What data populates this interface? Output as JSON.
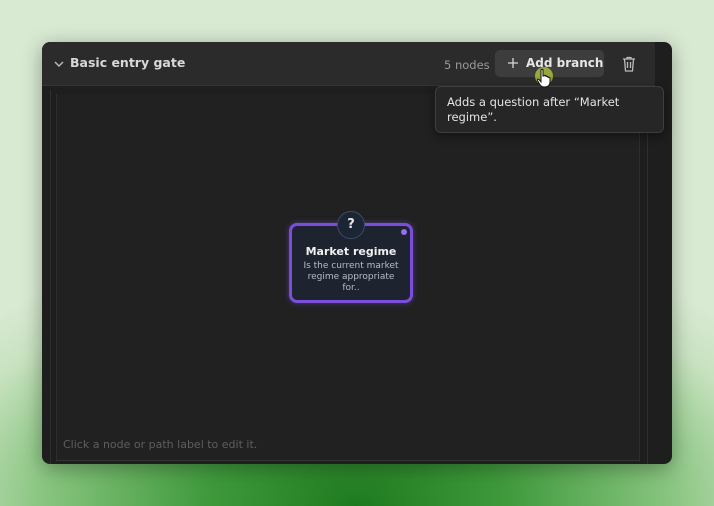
{
  "panel": {
    "title": "Basic entry gate",
    "node_count": "5 nodes",
    "add_branch_label": "Add branch",
    "hint": "Click a node or path label to edit it."
  },
  "tooltip": {
    "text": "Adds a question after “Market regime”."
  },
  "node": {
    "badge": "?",
    "title": "Market regime",
    "description": "Is the current market regime appropriate for..",
    "border_color": "#7c4ddb"
  },
  "icons": {
    "collapse": "chevron-down-icon",
    "add": "plus-icon",
    "delete": "trash-icon",
    "cursor": "hand-pointer-icon"
  }
}
